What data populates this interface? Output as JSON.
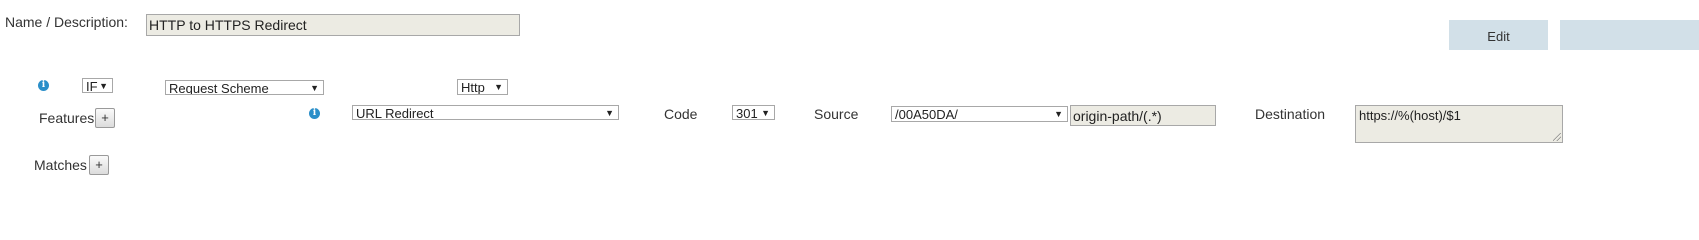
{
  "name_description": {
    "label": "Name / Description:",
    "value": "HTTP to HTTPS Redirect"
  },
  "actions": {
    "edit_label": "Edit"
  },
  "condition": {
    "info_icon": "info-icon",
    "operator_value": "IF",
    "variable_value": "Request Scheme",
    "match_value": "Http"
  },
  "features": {
    "label": "Features",
    "add_label": "+",
    "info_icon": "info-icon",
    "type_value": "URL Redirect",
    "code_label": "Code",
    "code_value": "301",
    "source_label": "Source",
    "source_value": "/00A50DA/",
    "source_path": "origin-path/(.*)",
    "destination_label": "Destination",
    "destination_value": "https://%(host)/$1"
  },
  "matches": {
    "label": "Matches",
    "add_label": "+"
  },
  "colors": {
    "info_blue": "#2b8fc9",
    "edit_bg": "#d2e0e8",
    "readonly_bg": "#ecebe3"
  }
}
